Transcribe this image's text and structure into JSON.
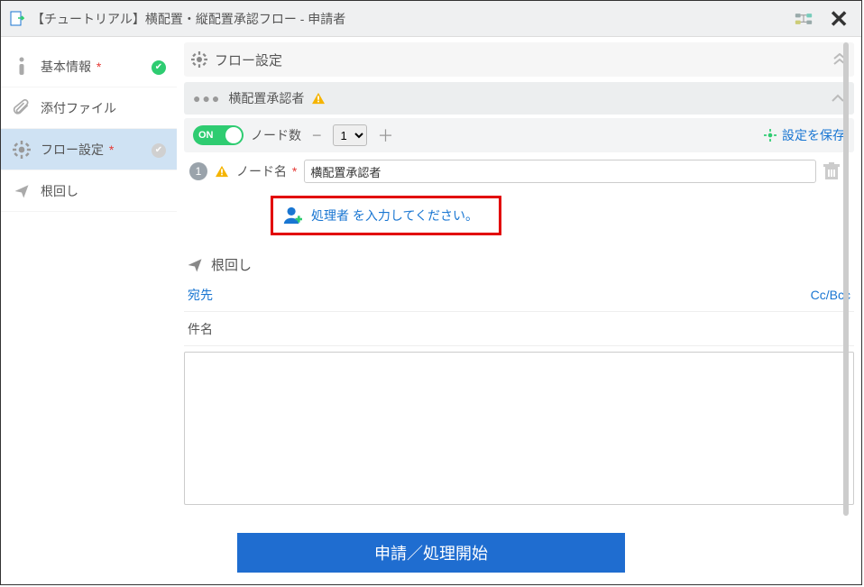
{
  "header": {
    "title": "【チュートリアル】横配置・縦配置承認フロー - 申請者"
  },
  "sidebar": {
    "items": [
      {
        "label": "基本情報",
        "required": true,
        "status": "ok"
      },
      {
        "label": "添付ファイル",
        "required": false,
        "status": ""
      },
      {
        "label": "フロー設定",
        "required": true,
        "status": "pending"
      },
      {
        "label": "根回し",
        "required": false,
        "status": ""
      }
    ]
  },
  "flow": {
    "section_title": "フロー設定",
    "approver_group_label": "横配置承認者",
    "toggle_label": "ON",
    "node_count_label": "ノード数",
    "node_count_value": "1",
    "save_label": "設定を保存",
    "node_number": "1",
    "node_name_label": "ノード名",
    "node_name_value": "横配置承認者",
    "processor_prompt": "処理者 を入力してください。"
  },
  "negawashi": {
    "title": "根回し",
    "to_label": "宛先",
    "ccbcc_label": "Cc/Bcc",
    "subject_label": "件名"
  },
  "footer": {
    "submit_label": "申請／処理開始"
  },
  "required_mark": "*"
}
